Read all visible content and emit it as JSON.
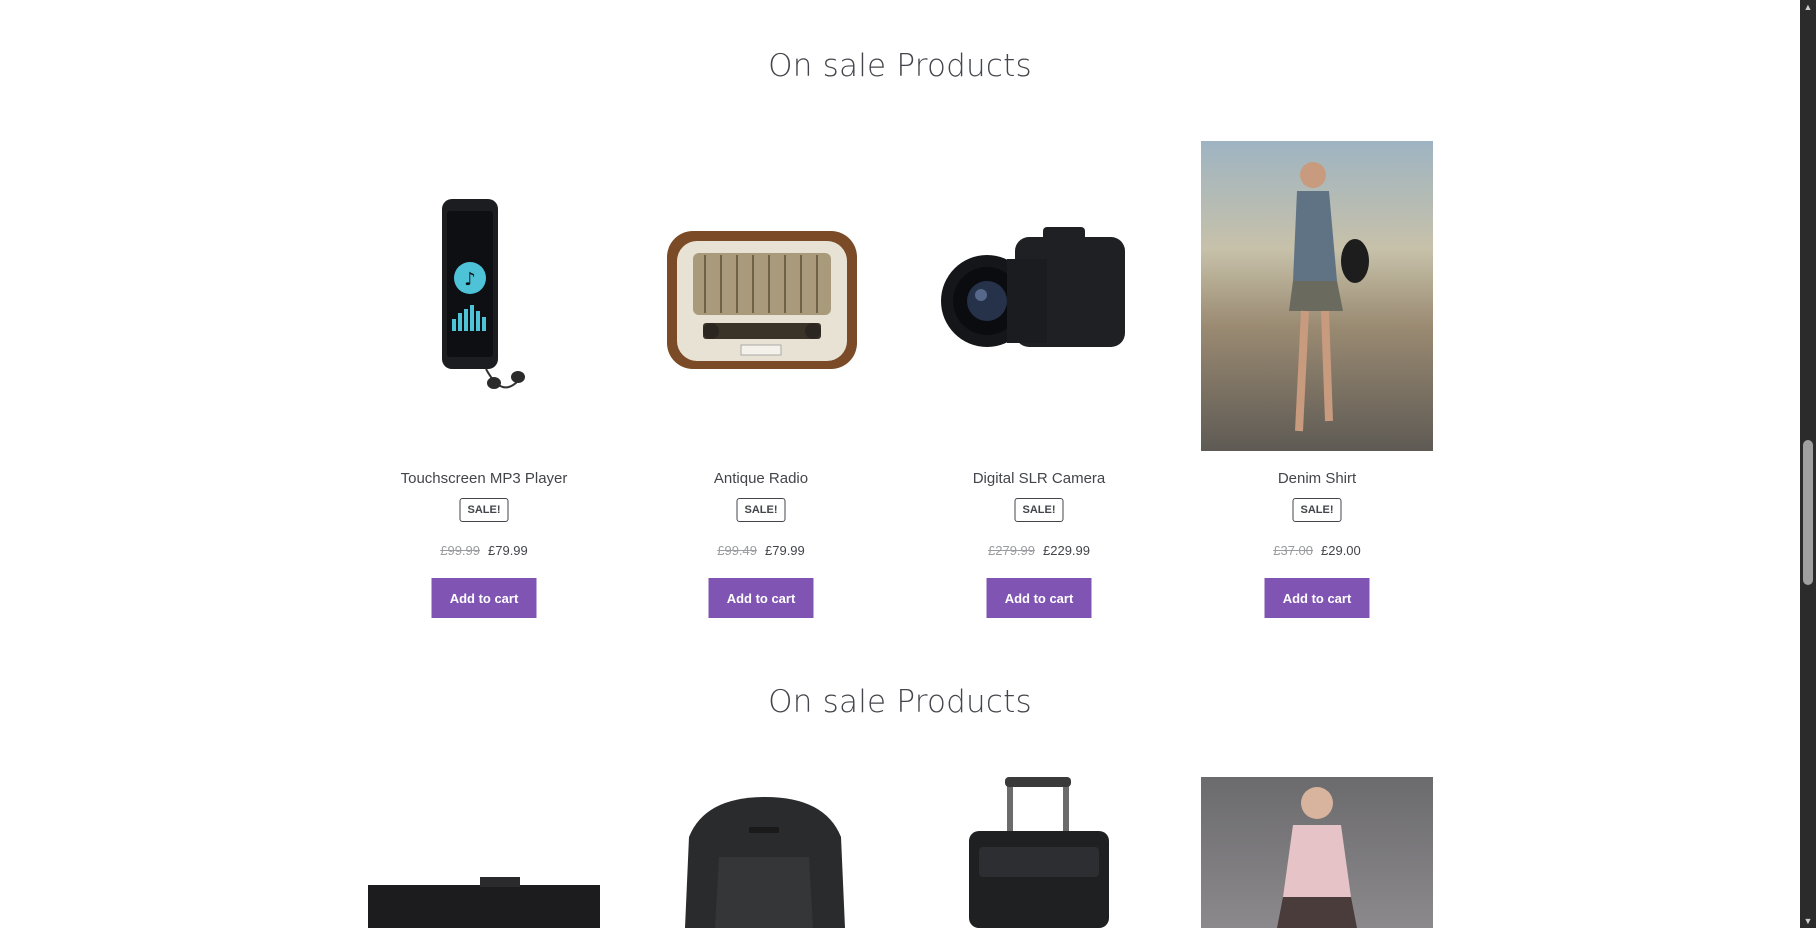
{
  "sections": [
    {
      "title": "On sale Products",
      "products": [
        {
          "name": "Touchscreen MP3 Player",
          "badge": "SALE!",
          "old_price": "£99.99",
          "price": "£79.99",
          "button": "Add to cart",
          "icon": "mp3-player-image"
        },
        {
          "name": "Antique Radio",
          "badge": "SALE!",
          "old_price": "£99.49",
          "price": "£79.99",
          "button": "Add to cart",
          "icon": "radio-image"
        },
        {
          "name": "Digital SLR Camera",
          "badge": "SALE!",
          "old_price": "£279.99",
          "price": "£229.99",
          "button": "Add to cart",
          "icon": "camera-image"
        },
        {
          "name": "Denim Shirt",
          "badge": "SALE!",
          "old_price": "£37.00",
          "price": "£29.00",
          "button": "Add to cart",
          "icon": "denim-shirt-image"
        }
      ]
    },
    {
      "title": "On sale Products",
      "products": [
        {
          "icon": "battery-grip-image"
        },
        {
          "icon": "backpack-image"
        },
        {
          "icon": "rolling-suitcase-image"
        },
        {
          "icon": "blouse-image"
        }
      ]
    }
  ],
  "colors": {
    "accent": "#7f54b3",
    "text": "#43454b",
    "muted": "#9a9ca0"
  }
}
